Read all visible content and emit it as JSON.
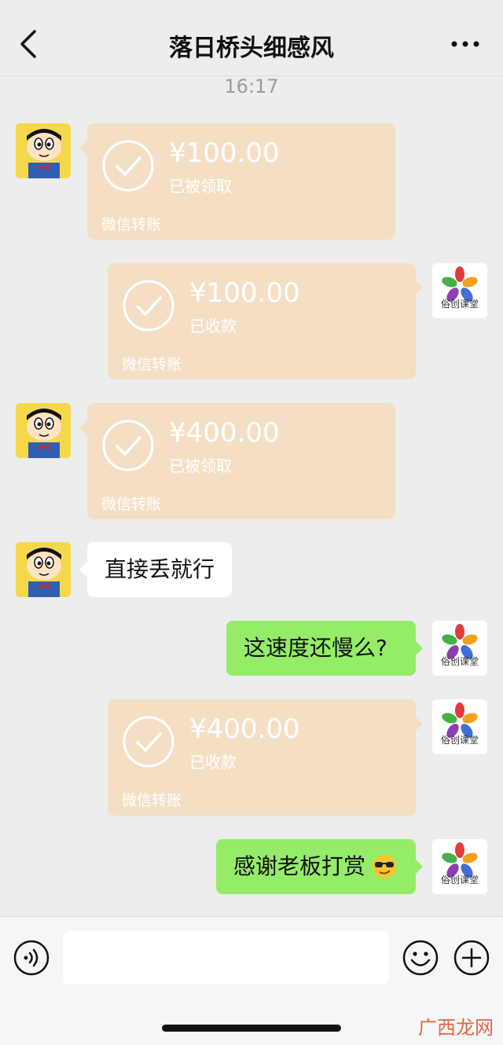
{
  "header": {
    "title": "落日桥头细感风"
  },
  "timestamp": "16:17",
  "contact_avatar": "crayon-shin-chan-avatar",
  "self_avatar": {
    "brand": "俗创课堂",
    "logo": "flower-logo"
  },
  "messages": [
    {
      "from": "contact",
      "type": "transfer",
      "amount": "¥100.00",
      "status": "已被领取",
      "label": "微信转账"
    },
    {
      "from": "self",
      "type": "transfer",
      "amount": "¥100.00",
      "status": "已收款",
      "label": "微信转账"
    },
    {
      "from": "contact",
      "type": "transfer",
      "amount": "¥400.00",
      "status": "已被领取",
      "label": "微信转账"
    },
    {
      "from": "contact",
      "type": "text",
      "text": "直接丢就行"
    },
    {
      "from": "self",
      "type": "text",
      "text": "这速度还慢么?"
    },
    {
      "from": "self",
      "type": "transfer",
      "amount": "¥400.00",
      "status": "已收款",
      "label": "微信转账"
    },
    {
      "from": "self",
      "type": "text",
      "text": "感谢老板打赏",
      "emoji": "sunglasses-emoji"
    }
  ],
  "input_bar": {
    "text_value": ""
  },
  "watermark": "广西龙网",
  "colors": {
    "background": "#ededed",
    "transfer_received": "#f4dfc5",
    "self_bubble": "#95ec69",
    "contact_bubble": "#ffffff"
  }
}
